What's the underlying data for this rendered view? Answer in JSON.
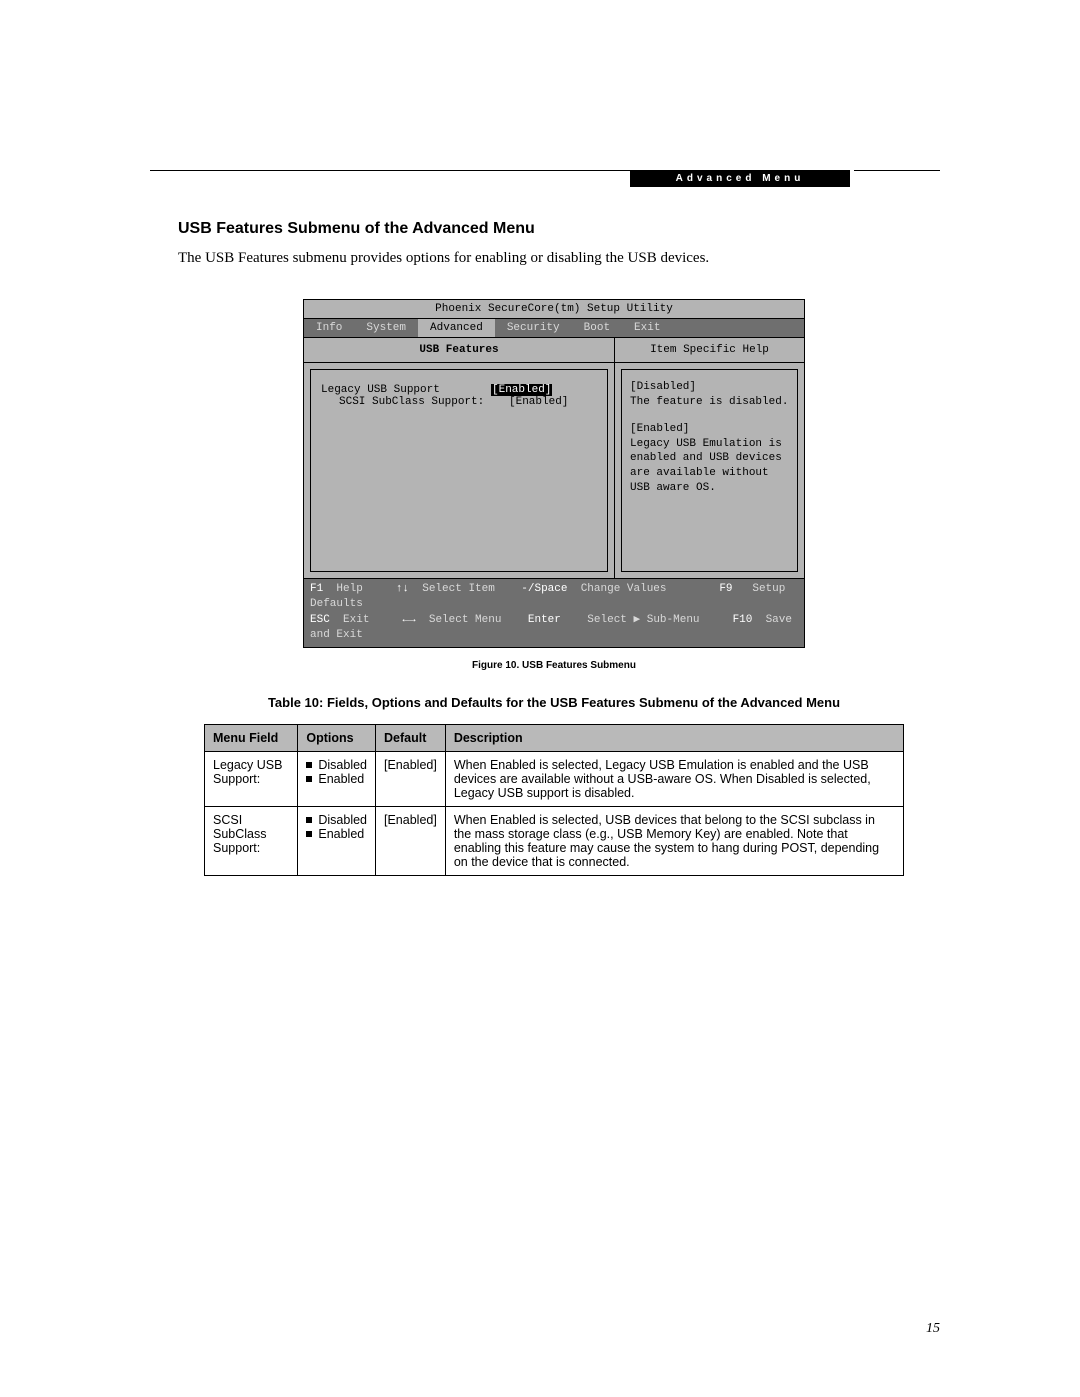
{
  "header": {
    "section_bar": "Advanced Menu"
  },
  "heading": "USB Features Submenu of the Advanced Menu",
  "intro": "The USB Features submenu provides options for enabling or disabling the USB devices.",
  "bios": {
    "title": "Phoenix SecureCore(tm) Setup Utility",
    "menus": [
      "Info",
      "System",
      "Advanced",
      "Security",
      "Boot",
      "Exit"
    ],
    "active_menu": "Advanced",
    "left_head": "USB Features",
    "options": [
      {
        "label": "Legacy USB Support",
        "value": "[Enabled]",
        "indent": false,
        "selected": true
      },
      {
        "label": "SCSI SubClass Support:",
        "value": "[Enabled]",
        "indent": true,
        "selected": false
      }
    ],
    "right_head": "Item Specific Help",
    "help": {
      "block1_title": "[Disabled]",
      "block1_text": "The feature is disabled.",
      "block2_title": "[Enabled]",
      "block2_text": "Legacy USB Emulation is enabled and USB devices are available without USB aware OS."
    },
    "footer": {
      "line1": {
        "k1": "F1",
        "l1": "Help",
        "k2": "↑↓",
        "l2": "Select Item",
        "k3": "-/Space",
        "l3": "Change Values",
        "k4": "F9",
        "l4": "Setup Defaults"
      },
      "line2": {
        "k1": "ESC",
        "l1": "Exit",
        "k2": "←→",
        "l2": "Select Menu",
        "k3": "Enter",
        "l3": "Select ▶ Sub-Menu",
        "k4": "F10",
        "l4": "Save and Exit"
      }
    }
  },
  "figure_caption": "Figure 10.  USB Features Submenu",
  "table_title": "Table 10: Fields, Options and Defaults for the USB Features Submenu of the Advanced Menu",
  "table": {
    "headers": [
      "Menu Field",
      "Options",
      "Default",
      "Description"
    ],
    "rows": [
      {
        "field": "Legacy USB Support:",
        "options": [
          "Disabled",
          "Enabled"
        ],
        "default": "[Enabled]",
        "description": "When Enabled is selected, Legacy USB Emulation is enabled and the USB devices are available without a USB-aware OS. When Disabled is selected, Legacy USB support is disabled."
      },
      {
        "field": "SCSI SubClass Support:",
        "options": [
          "Disabled",
          "Enabled"
        ],
        "default": "[Enabled]",
        "description": "When Enabled is selected, USB devices that belong to the SCSI subclass in the mass storage class (e.g., USB Memory Key) are enabled. Note that enabling this feature may cause the system to hang during POST, depending on the device that is connected."
      }
    ]
  },
  "page_number": "15"
}
